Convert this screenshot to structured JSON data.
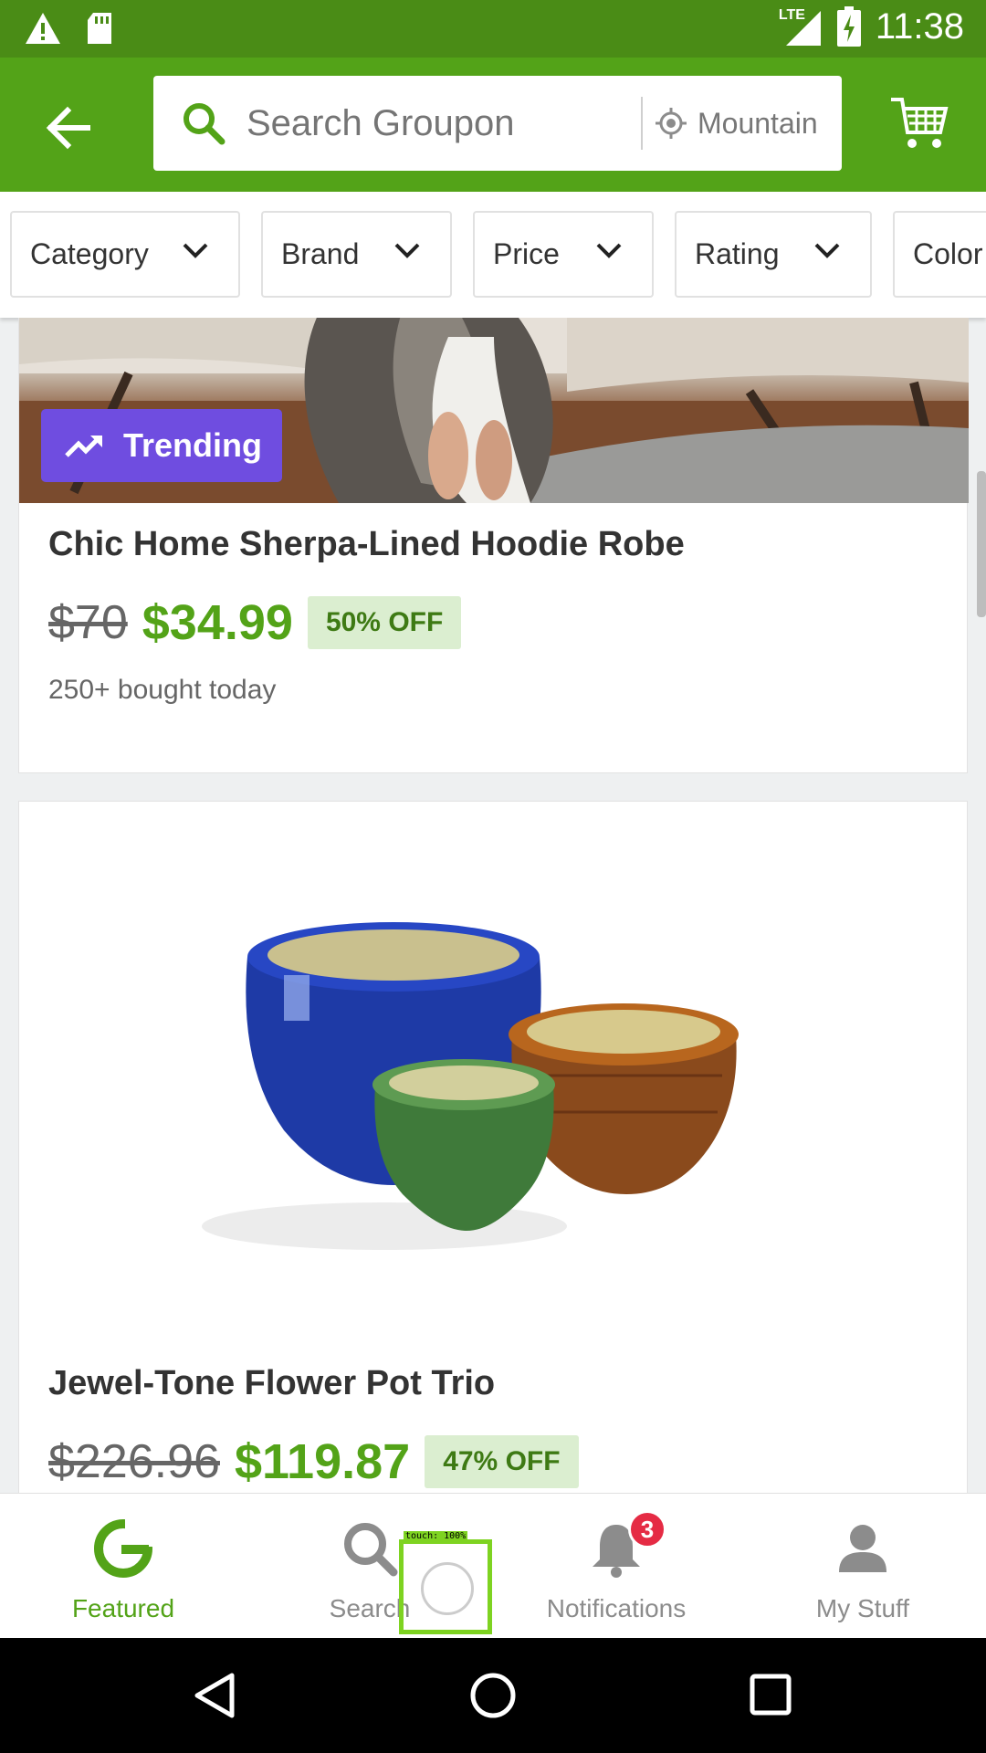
{
  "status_bar": {
    "time": "11:38",
    "network": "LTE"
  },
  "app_bar": {
    "search_placeholder": "Search Groupon",
    "location_text": "Mountain"
  },
  "filters": [
    {
      "label": "Category"
    },
    {
      "label": "Brand"
    },
    {
      "label": "Price"
    },
    {
      "label": "Rating"
    },
    {
      "label": "Color"
    }
  ],
  "deals": [
    {
      "badge": "Trending",
      "title": "Chic Home Sherpa-Lined Hoodie Robe",
      "original_price": "$70",
      "price": "$34.99",
      "discount": "50% OFF",
      "bought": "250+ bought today"
    },
    {
      "title": "Jewel-Tone Flower Pot Trio",
      "original_price": "$226.96",
      "price": "$119.87",
      "discount": "47% OFF"
    }
  ],
  "bottom_nav": {
    "featured": "Featured",
    "search": "Search",
    "notifications": "Notifications",
    "notifications_badge": "3",
    "my_stuff": "My Stuff"
  },
  "touch_indicator": {
    "label": "touch: 100%"
  },
  "colors": {
    "brand_green": "#53a318",
    "status_green": "#4a8c16",
    "trending_purple": "#6f4de0",
    "badge_red": "#e52b44"
  }
}
